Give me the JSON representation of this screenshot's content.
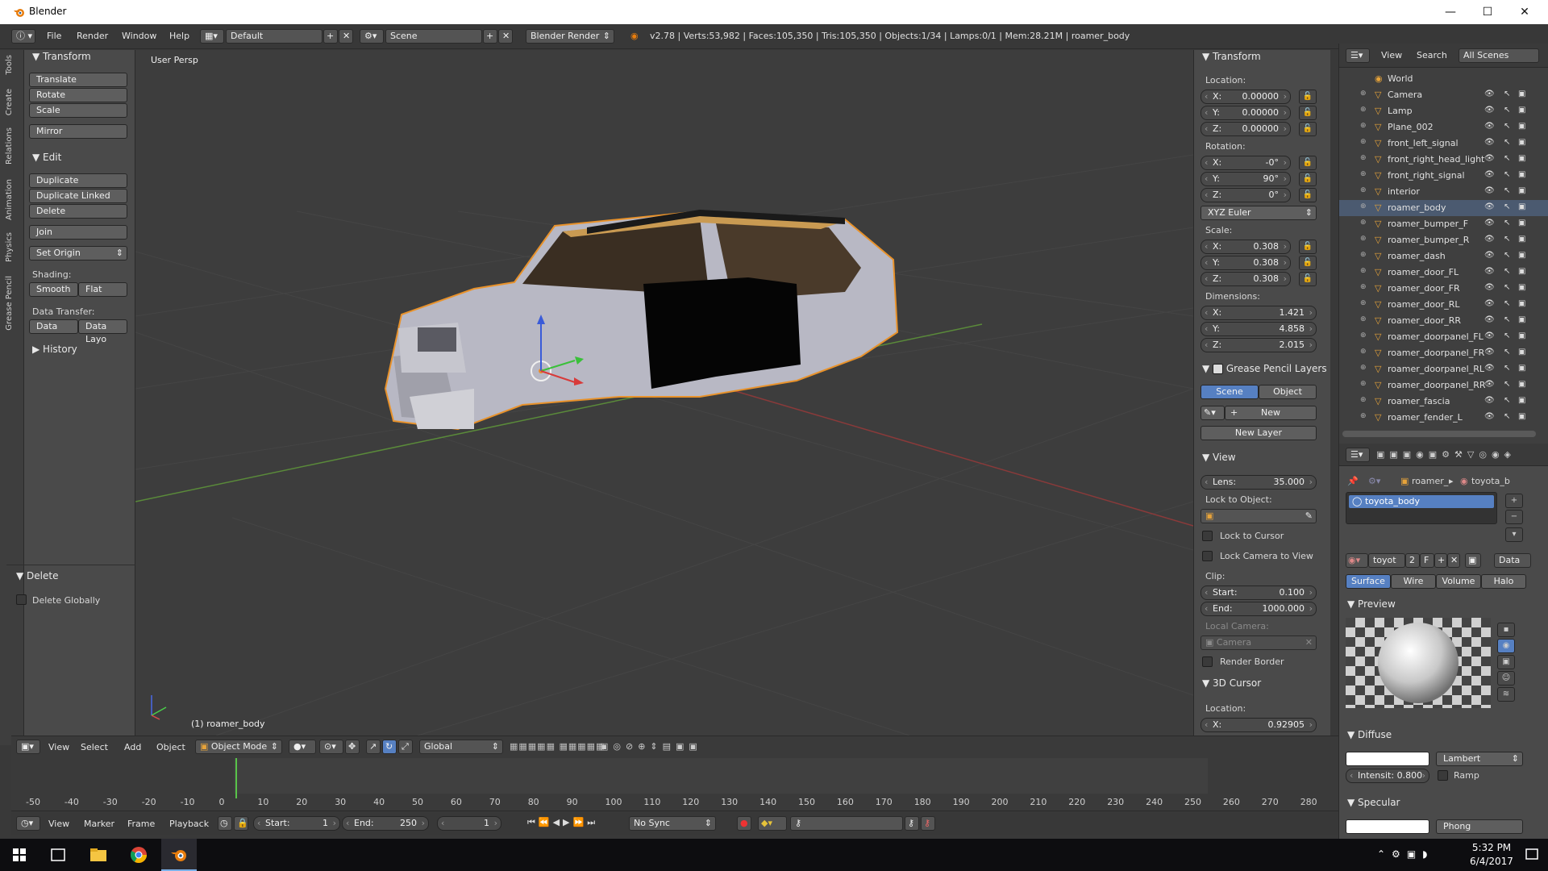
{
  "window": {
    "title": "Blender",
    "minimize": "—",
    "maximize": "☐",
    "close": "✕"
  },
  "info": {
    "menus": [
      "File",
      "Render",
      "Window",
      "Help"
    ],
    "layout": "Default",
    "scene": "Scene",
    "engine": "Blender Render",
    "stats": "v2.78 | Verts:53,982 | Faces:105,350 | Tris:105,350 | Objects:1/34 | Lamps:0/1 | Mem:28.21M | roamer_body"
  },
  "tabs": [
    "Tools",
    "Create",
    "Relations",
    "Animation",
    "Physics",
    "Grease Pencil"
  ],
  "tools": {
    "transform_header": "Transform",
    "translate": "Translate",
    "rotate": "Rotate",
    "scale": "Scale",
    "mirror": "Mirror",
    "edit_header": "Edit",
    "duplicate": "Duplicate",
    "duplicate_linked": "Duplicate Linked",
    "delete": "Delete",
    "join": "Join",
    "set_origin": "Set Origin",
    "shading_label": "Shading:",
    "smooth": "Smooth",
    "flat": "Flat",
    "data_transfer_label": "Data Transfer:",
    "data": "Data",
    "data_layout": "Data Layo",
    "history_header": "History",
    "delete_header": "Delete",
    "delete_globally": "Delete Globally"
  },
  "viewport": {
    "view_name": "User Persp",
    "active_object": "(1) roamer_body"
  },
  "npanel": {
    "transform_header": "Transform",
    "location_label": "Location:",
    "loc": [
      {
        "axis": "X:",
        "value": "0.00000"
      },
      {
        "axis": "Y:",
        "value": "0.00000"
      },
      {
        "axis": "Z:",
        "value": "0.00000"
      }
    ],
    "rotation_label": "Rotation:",
    "rot": [
      {
        "axis": "X:",
        "value": "-0°"
      },
      {
        "axis": "Y:",
        "value": "90°"
      },
      {
        "axis": "Z:",
        "value": "0°"
      }
    ],
    "rotation_mode": "XYZ Euler",
    "scale_label": "Scale:",
    "scale": [
      {
        "axis": "X:",
        "value": "0.308"
      },
      {
        "axis": "Y:",
        "value": "0.308"
      },
      {
        "axis": "Z:",
        "value": "0.308"
      }
    ],
    "dimensions_label": "Dimensions:",
    "dims": [
      {
        "axis": "X:",
        "value": "1.421"
      },
      {
        "axis": "Y:",
        "value": "4.858"
      },
      {
        "axis": "Z:",
        "value": "2.015"
      }
    ],
    "gp_header": "Grease Pencil Layers",
    "gp_scene": "Scene",
    "gp_object": "Object",
    "gp_new": "New",
    "gp_new_layer": "New Layer",
    "view_header": "View",
    "lens_label": "Lens:",
    "lens_value": "35.000",
    "lock_object_label": "Lock to Object:",
    "lock_cursor": "Lock to Cursor",
    "lock_camera": "Lock Camera to View",
    "clip_label": "Clip:",
    "clip_start_label": "Start:",
    "clip_start": "0.100",
    "clip_end_label": "End:",
    "clip_end": "1000.000",
    "local_camera_label": "Local Camera:",
    "local_camera": "Camera",
    "render_border": "Render Border",
    "cursor_header": "3D Cursor",
    "cursor_location_label": "Location:",
    "cursor_x_label": "X:",
    "cursor_x": "0.92905"
  },
  "outliner": {
    "view": "View",
    "search": "Search",
    "filter": "All Scenes",
    "items": [
      "World",
      "Camera",
      "Lamp",
      "Plane_002",
      "front_left_signal",
      "front_right_head_light",
      "front_right_signal",
      "interior",
      "roamer_body",
      "roamer_bumper_F",
      "roamer_bumper_R",
      "roamer_dash",
      "roamer_door_FL",
      "roamer_door_FR",
      "roamer_door_RL",
      "roamer_door_RR",
      "roamer_doorpanel_FL",
      "roamer_doorpanel_FR",
      "roamer_doorpanel_RL",
      "roamer_doorpanel_RR",
      "roamer_fascia",
      "roamer_fender_L"
    ]
  },
  "props": {
    "crumb_object": "roamer_",
    "crumb_material": "toyota_b",
    "material_slot": "toyota_body",
    "mat_name": "toyot",
    "mat_users": "2",
    "mat_fake": "F",
    "data_mode": "Data",
    "tabs": [
      "Surface",
      "Wire",
      "Volume",
      "Halo"
    ],
    "preview_header": "Preview",
    "diffuse_header": "Diffuse",
    "diffuse_shader": "Lambert",
    "intensity": "Intensit: 0.800",
    "ramp": "Ramp",
    "specular_header": "Specular",
    "specular_shader": "Phong"
  },
  "vpheader": {
    "view": "View",
    "select": "Select",
    "add": "Add",
    "object": "Object",
    "mode": "Object Mode",
    "orientation": "Global"
  },
  "timeline": {
    "ticks": [
      "-50",
      "-40",
      "-30",
      "-20",
      "-10",
      "0",
      "10",
      "20",
      "30",
      "40",
      "50",
      "60",
      "70",
      "80",
      "90",
      "100",
      "110",
      "120",
      "130",
      "140",
      "150",
      "160",
      "170",
      "180",
      "190",
      "200",
      "210",
      "220",
      "230",
      "240",
      "250",
      "260",
      "270",
      "280"
    ],
    "view": "View",
    "marker": "Marker",
    "frame": "Frame",
    "playback": "Playback",
    "start_label": "Start:",
    "start": "1",
    "end_label": "End:",
    "end": "250",
    "current": "1",
    "sync": "No Sync"
  },
  "taskbar": {
    "time": "5:32 PM",
    "date": "6/4/2017"
  }
}
